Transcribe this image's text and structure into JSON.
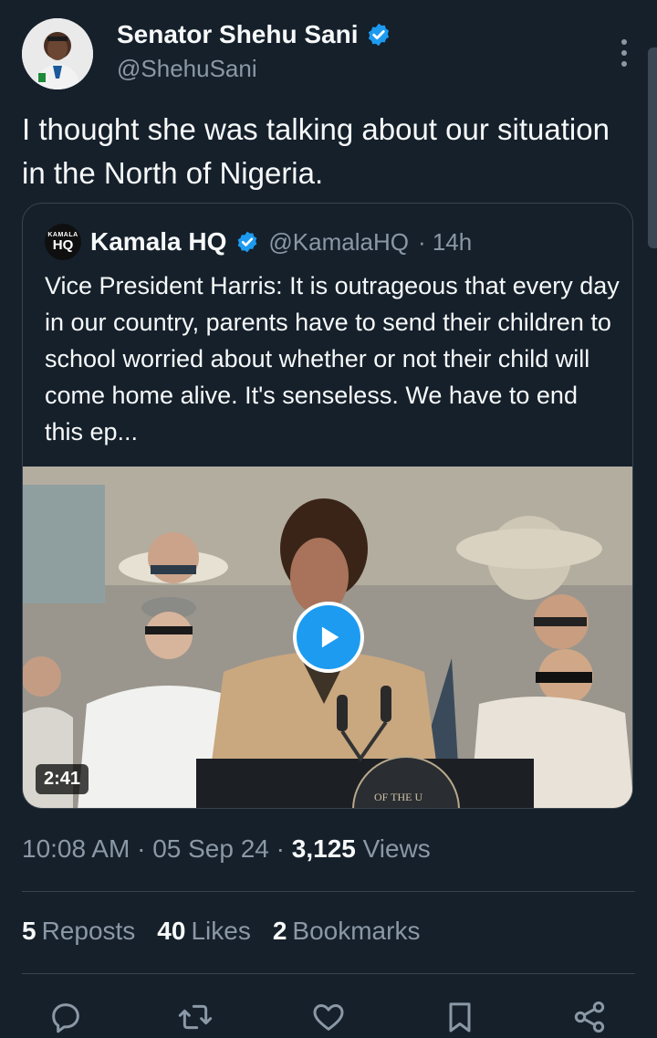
{
  "author": {
    "name": "Senator Shehu Sani",
    "handle": "@ShehuSani"
  },
  "tweet": {
    "text": "I thought she was talking about our situation in the North of Nigeria."
  },
  "quoted": {
    "logo_small": "KAMALA",
    "logo_big": "HQ",
    "name": "Kamala HQ",
    "handle": "@KamalaHQ",
    "time": "· 14h",
    "text": "Vice President Harris: It is outrageous that every day in our country, parents have to send their children to school worried about whether or not their child will come home alive. It's senseless. We have to end this ep...",
    "video_duration": "2:41",
    "seal_text": "OF THE U"
  },
  "meta": {
    "time": "10:08 AM",
    "date": "05 Sep 24",
    "views_count": "3,125",
    "views_label": "Views"
  },
  "stats": {
    "reposts_count": "5",
    "reposts_label": "Reposts",
    "likes_count": "40",
    "likes_label": "Likes",
    "bookmarks_count": "2",
    "bookmarks_label": "Bookmarks"
  },
  "colors": {
    "background": "#15202b",
    "accent": "#1d9bf0",
    "muted": "#8b98a5",
    "border": "#38444d"
  },
  "icons": [
    "verified-badge-icon",
    "more-options-icon",
    "play-icon",
    "reply-icon",
    "repost-icon",
    "like-icon",
    "bookmark-icon",
    "share-icon"
  ]
}
